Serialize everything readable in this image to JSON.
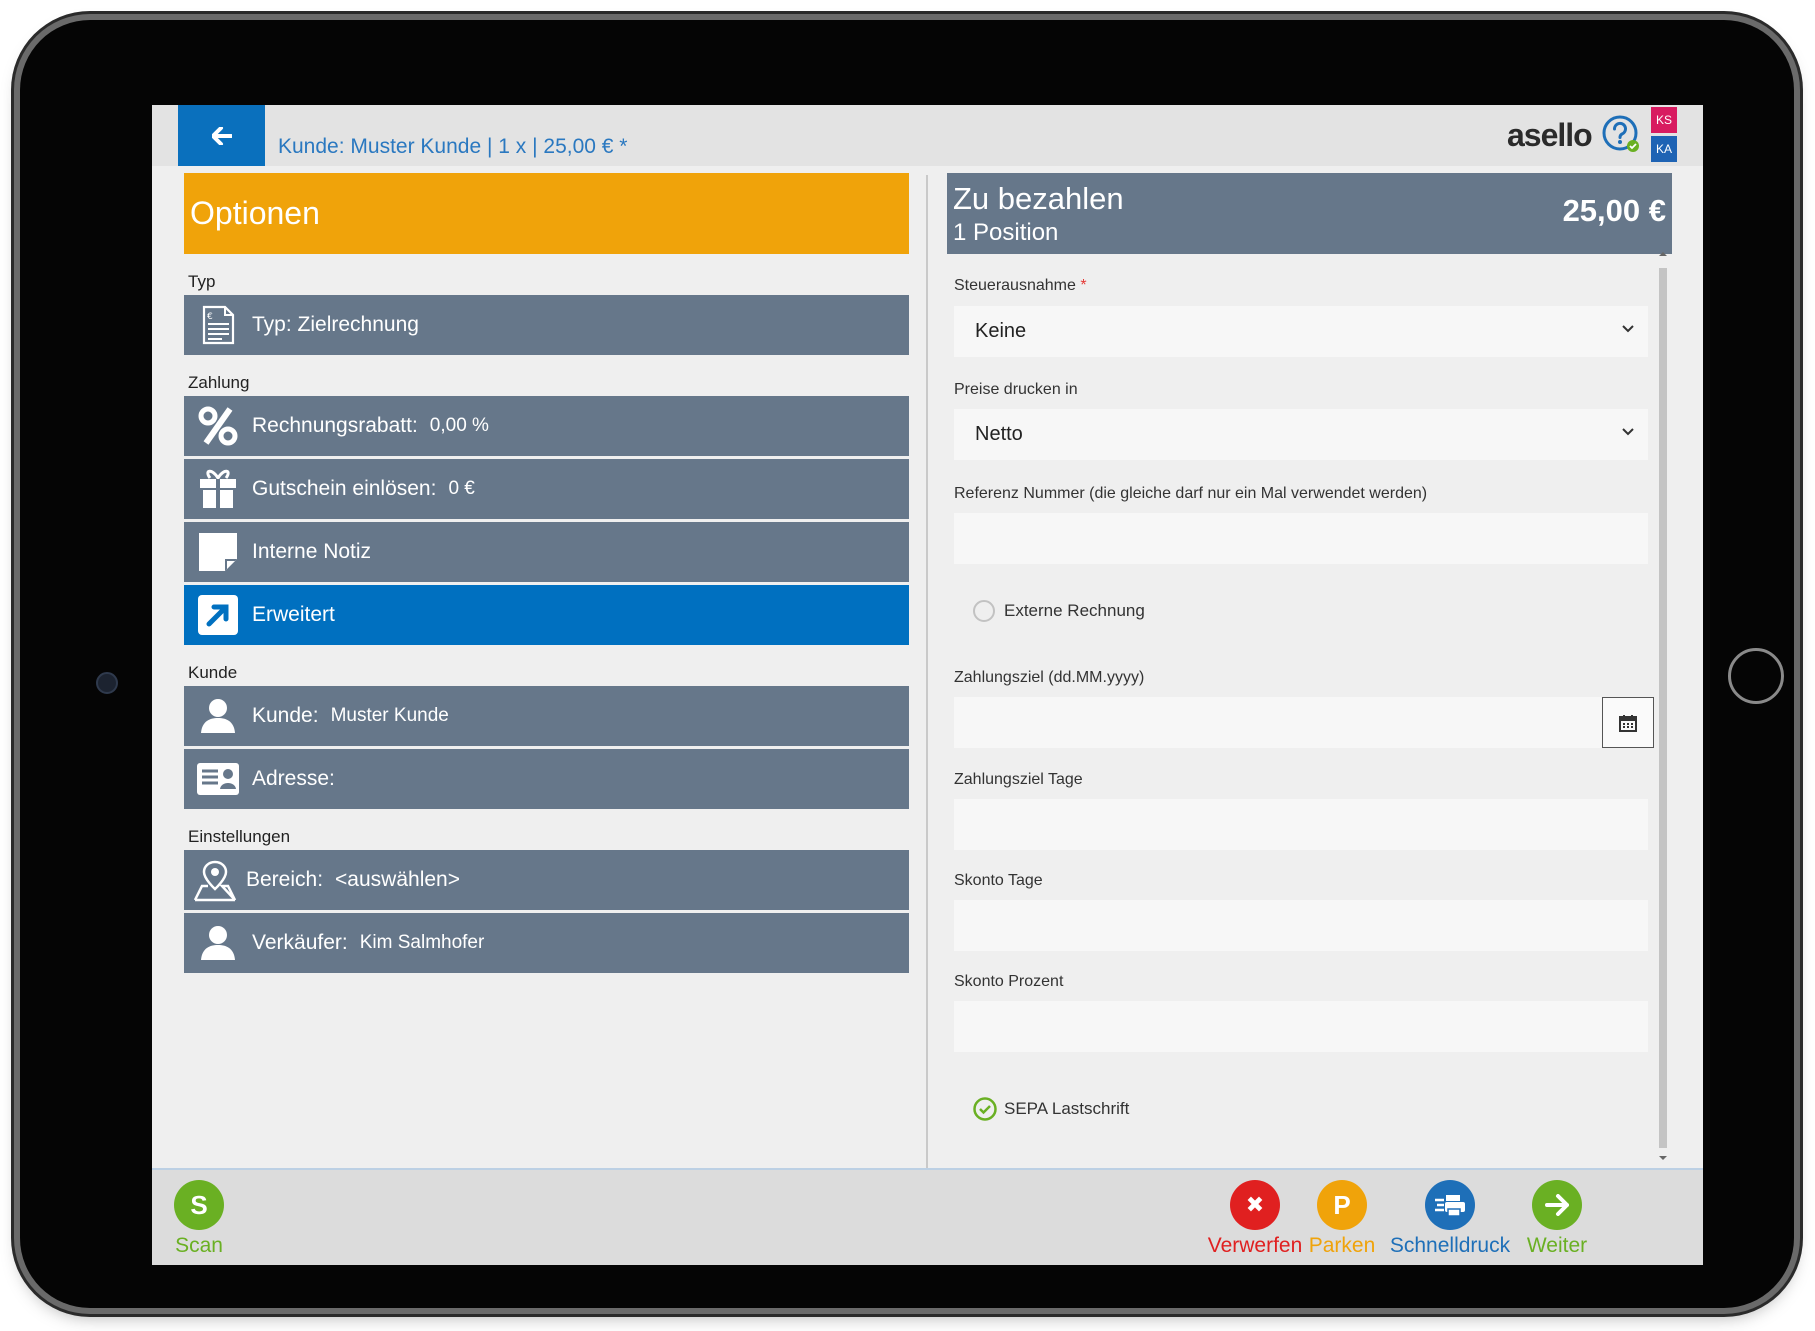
{
  "topbar": {
    "breadcrumb": "Kunde: Muster Kunde | 1 x | 25,00 € *",
    "logo": "asello",
    "badge_top": "KS",
    "badge_bottom": "KA"
  },
  "options": {
    "title": "Optionen",
    "sections": {
      "typ": "Typ",
      "zahlung": "Zahlung",
      "kunde": "Kunde",
      "einstellungen": "Einstellungen"
    },
    "rows": {
      "typ": {
        "label": "Typ: Zielrechnung",
        "icon": "invoice-icon"
      },
      "rabatt": {
        "label": "Rechnungsrabatt:",
        "value": "0,00 %",
        "icon": "percent-icon"
      },
      "gutschein": {
        "label": "Gutschein einlösen:",
        "value": "0 €",
        "icon": "gift-icon"
      },
      "notiz": {
        "label": "Interne Notiz",
        "icon": "note-icon"
      },
      "erweitert": {
        "label": "Erweitert",
        "icon": "expand-arrow-icon"
      },
      "kunde": {
        "label": "Kunde:",
        "value": "Muster Kunde",
        "icon": "person-icon"
      },
      "adresse": {
        "label": "Adresse:",
        "icon": "address-card-icon"
      },
      "bereich": {
        "label": "Bereich:",
        "value": "<auswählen>",
        "icon": "map-pin-icon"
      },
      "verkaeufer": {
        "label": "Verkäufer:",
        "value": "Kim Salmhofer",
        "icon": "person-icon"
      }
    }
  },
  "payment": {
    "title": "Zu bezahlen",
    "positions": "1 Position",
    "total": "25,00 €"
  },
  "form": {
    "steuerausnahme": {
      "label": "Steuerausnahme",
      "required_mark": "*",
      "value": "Keine"
    },
    "preise": {
      "label": "Preise drucken in",
      "value": "Netto"
    },
    "referenz": {
      "label": "Referenz Nummer (die gleiche darf nur ein Mal verwendet werden)",
      "value": ""
    },
    "externe_rechnung": {
      "label": "Externe Rechnung",
      "checked": false
    },
    "zahlungsziel": {
      "label": "Zahlungsziel (dd.MM.yyyy)",
      "value": ""
    },
    "zahlungsziel_tage": {
      "label": "Zahlungsziel Tage",
      "value": ""
    },
    "skonto_tage": {
      "label": "Skonto Tage",
      "value": ""
    },
    "skonto_prozent": {
      "label": "Skonto Prozent",
      "value": ""
    },
    "sepa": {
      "label": "SEPA Lastschrift",
      "checked": true
    }
  },
  "actions": {
    "scan": {
      "label": "Scan",
      "glyph": "S",
      "color": "#6ab023"
    },
    "verwerfen": {
      "label": "Verwerfen",
      "glyph": "✖",
      "color": "#e02020"
    },
    "parken": {
      "label": "Parken",
      "glyph": "P",
      "color": "#f0a30a"
    },
    "schnelldruck": {
      "label": "Schnelldruck",
      "icon": "printer-icon",
      "color": "#1e6fb8"
    },
    "weiter": {
      "label": "Weiter",
      "icon": "arrow-right-icon",
      "color": "#6ab023"
    }
  },
  "colors": {
    "accent_blue": "#0070c0",
    "header_orange": "#f0a30a",
    "row_slate": "#66778a"
  }
}
